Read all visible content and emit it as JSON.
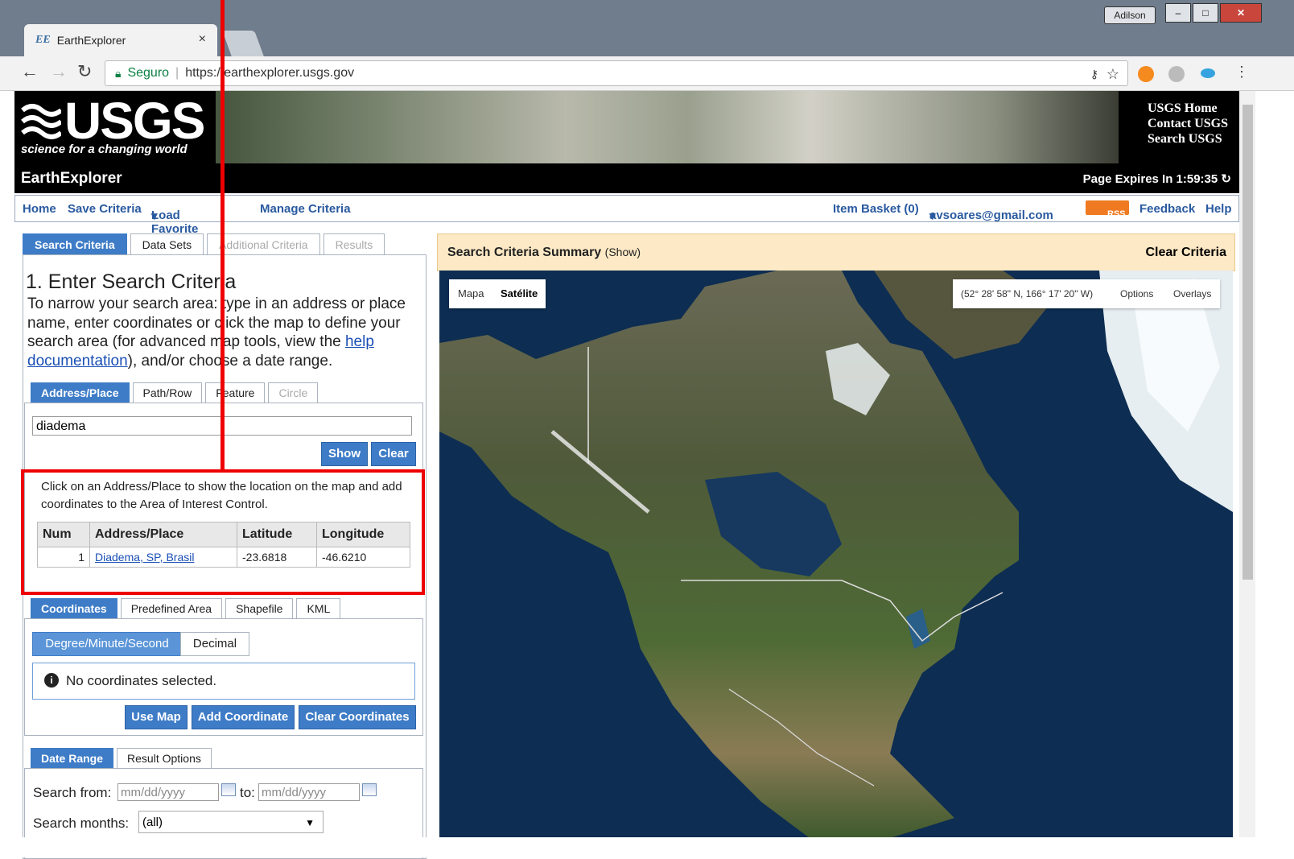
{
  "browser": {
    "tab_title": "EarthExplorer",
    "tab_icon": "EE",
    "tab_close": "×",
    "user": "Adilson",
    "secure_label": "Seguro",
    "url": "https://earthexplorer.usgs.gov"
  },
  "header": {
    "logo": "USGS",
    "tagline": "science for a changing world",
    "links": [
      "USGS Home",
      "Contact USGS",
      "Search USGS"
    ],
    "app_title": "EarthExplorer",
    "expires": "Page Expires In 1:59:35"
  },
  "menu": {
    "home": "Home",
    "save": "Save Criteria",
    "load": "Load Favorite",
    "manage": "Manage Criteria",
    "basket": "Item Basket (0)",
    "account": "avsoares@gmail.com",
    "rss": "RSS",
    "feedback": "Feedback",
    "help": "Help"
  },
  "left_tabs": [
    "Search Criteria",
    "Data Sets",
    "Additional Criteria",
    "Results"
  ],
  "section1": {
    "title": "1. Enter Search Criteria",
    "intro_a": "To narrow your search area: type in an address or place name, enter coordinates or click the map to define your search area (for advanced map tools, view the ",
    "intro_link": "help documentation",
    "intro_b": "), and/or choose a date range."
  },
  "addr_tabs": [
    "Address/Place",
    "Path/Row",
    "Feature",
    "Circle"
  ],
  "address": {
    "value": "diadema",
    "show": "Show",
    "clear": "Clear",
    "info": "Click on an Address/Place to show the location on the map and add coordinates to the Area of Interest Control.",
    "columns": [
      "Num",
      "Address/Place",
      "Latitude",
      "Longitude"
    ],
    "rows": [
      [
        "1",
        "Diadema, SP, Brasil",
        "-23.6818",
        "-46.6210"
      ]
    ]
  },
  "coord_tabs": [
    "Coordinates",
    "Predefined Area",
    "Shapefile",
    "KML"
  ],
  "coords": {
    "dms": "Degree/Minute/Second",
    "decimal": "Decimal",
    "none": "No coordinates selected.",
    "use_map": "Use Map",
    "add": "Add Coordinate",
    "clear": "Clear Coordinates"
  },
  "date_tabs": [
    "Date Range",
    "Result Options"
  ],
  "dates": {
    "from_label": "Search from:",
    "from_placeholder": "mm/dd/yyyy",
    "to_label": "to:",
    "to_placeholder": "mm/dd/yyyy",
    "months_label": "Search months:",
    "months_value": "(all)"
  },
  "summary": {
    "title": "Search Criteria Summary",
    "show": "(Show)",
    "clear": "Clear Criteria"
  },
  "map": {
    "type_map": "Mapa",
    "type_sat": "Satélite",
    "coords": "(52° 28' 58\" N, 166° 17' 20\" W)",
    "options": "Options",
    "overlays": "Overlays"
  },
  "colors": {
    "accent": "#3e7cc7",
    "highlight": "#e00000",
    "summary_bg": "#fde9c5"
  }
}
